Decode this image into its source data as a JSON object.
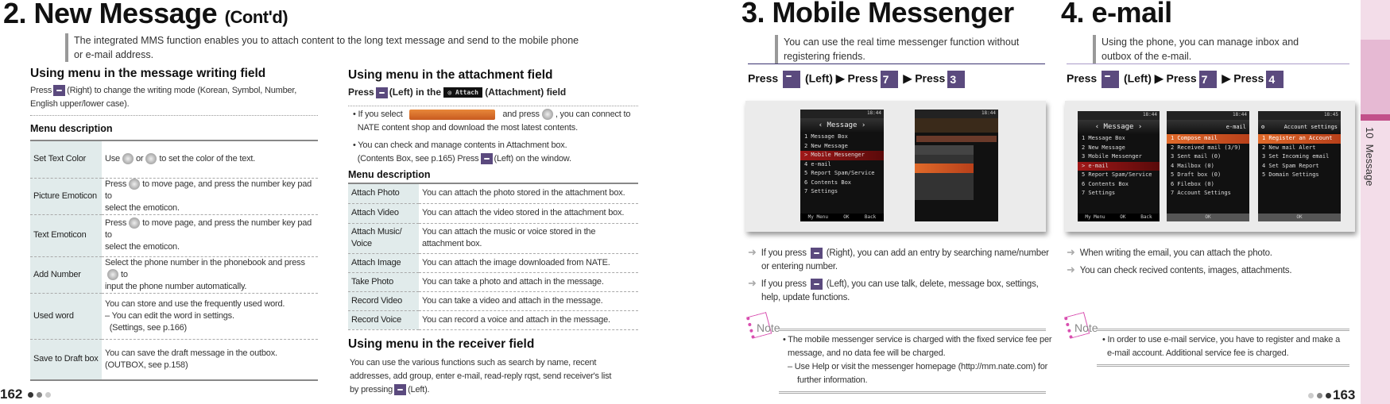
{
  "left_page": {
    "title_num": "2.",
    "title": "New Message",
    "title_suffix": "(Cont'd)",
    "intro": [
      "The integrated MMS function enables you to attach content to the long text message and send to the mobile phone",
      "or e-mail address."
    ],
    "writing_field": {
      "heading": "Using menu in the message writing field",
      "text_pre": "Press",
      "text_post": "(Right) to change the writing mode (Korean, Symbol, Number,",
      "text_line2": "English upper/lower case).",
      "menu_heading": "Menu description",
      "rows": [
        {
          "name": "Set Text Color",
          "desc": [
            "Use",
            "or",
            "to set the color of the text."
          ]
        },
        {
          "name": "Picture Emoticon",
          "desc": [
            "Press",
            "to move page, and press the number key pad to",
            "select the emoticon."
          ]
        },
        {
          "name": "Text Emoticon",
          "desc": [
            "Press",
            "to move page, and  press the number key pad to",
            "select the emoticon."
          ]
        },
        {
          "name": "Add Number",
          "desc": [
            "Select the phone number in the phonebook and press",
            "to",
            "input the phone number automatically."
          ]
        },
        {
          "name": "Used word",
          "desc": [
            "You can store and use the frequently used word.",
            "–  You can edit the word in settings.",
            "(Settings, see p.166)"
          ]
        },
        {
          "name": "Save to Draft box",
          "desc": [
            "You can save the draft message in the outbox.",
            "(OUTBOX, see p.158)"
          ]
        }
      ]
    },
    "attachment_field": {
      "heading": "Using menu in the attachment field",
      "press": "Press",
      "press_mid": "(Left)  in  the",
      "attach_chip": "Attach",
      "press_end": "(Attachment)  field",
      "bullet1": [
        "• If you select",
        "and press",
        ", you can connect to",
        "NATE content shop and download the most latest contents."
      ],
      "bullet2": [
        "• You can check and manage contents in Attachment box.",
        "(Contents Box, see p.165) Press",
        "(Left) on the window."
      ],
      "menu_heading": "Menu description",
      "rows": [
        {
          "name": "Attach Photo",
          "desc": "You can attach the photo stored in the attachment box."
        },
        {
          "name": "Attach Video",
          "desc": "You can attach the video stored in the attachment box."
        },
        {
          "name": "Attach Music/ Voice",
          "desc": "You can attach the music or voice stored in the attachment box."
        },
        {
          "name": "Attach Image",
          "desc": "You can attach the image downloaded from NATE."
        },
        {
          "name": "Take Photo",
          "desc": "You can take a photo and attach in the message."
        },
        {
          "name": "Record Video",
          "desc": "You can take a video and attach in the message."
        },
        {
          "name": "Record Voice",
          "desc": "You can record a voice and attach in the message."
        }
      ]
    },
    "receiver_field": {
      "heading": "Using menu in the receiver field",
      "lines": [
        "You can use the various functions such as search by name, recent",
        "addresses, add group, enter e-mail, read-reply rqst, send receiver's list",
        "by pressing"
      ],
      "end": "(Left)."
    },
    "page_number": "162"
  },
  "messenger": {
    "title_num": "3.",
    "title": "Mobile Messenger",
    "intro": [
      "You can use the real time messenger function without",
      "registering friends."
    ],
    "steps": {
      "press": "Press",
      "left": "(Left)",
      "key1": "7",
      "key2": "3"
    },
    "phone1": {
      "status": "18:44",
      "header": "Message",
      "items": [
        "1 Message Box",
        "2 New Message",
        "> Mobile Messenger",
        "4 e-mail",
        "5 Report Spam/Service",
        "6 Contents Box",
        "7 Settings"
      ],
      "selected": 2,
      "footer": [
        "My Menu",
        "OK",
        "Back"
      ]
    },
    "phone2": {
      "status": "18:44"
    },
    "bullets": [
      [
        "If you press",
        "(Right), you can add an entry by searching name/number",
        "or entering number."
      ],
      [
        "If you press",
        "(Left), you can use talk, delete, message box, settings,",
        "help, update functions."
      ]
    ],
    "note_label": "Note",
    "note": [
      "• The mobile messenger service is charged with the fixed service fee per",
      "message, and no data fee will be charged.",
      "–  Use Help or visit the messenger homepage (http://mm.nate.com) for",
      "further information."
    ]
  },
  "email": {
    "title_num": "4.",
    "title": "e-mail",
    "intro": [
      "Using the phone, you can manage inbox and",
      "outbox of the e-mail."
    ],
    "steps": {
      "press": "Press",
      "left": "(Left)",
      "key1": "7",
      "key2": "4"
    },
    "phone1": {
      "status": "18:44",
      "header": "Message",
      "items": [
        "1 Message Box",
        "2 New Message",
        "3 Mobile Messenger",
        "> e-mail",
        "5 Report Spam/Service",
        "6 Contents Box",
        "7 Settings"
      ],
      "selected": 3,
      "footer": [
        "My Menu",
        "OK",
        "Back"
      ]
    },
    "phone2": {
      "status": "18:44",
      "header": "e-mail",
      "items": [
        "1 Compose mail",
        "2 Received mail (3/9)",
        "3 Sent mail (0)",
        "4 Mailbox (0)",
        "5 Draft box (0)",
        "6 Filebox (0)",
        "7 Account Settings"
      ],
      "selected": 0,
      "footer": [
        "OK"
      ]
    },
    "phone3": {
      "status": "18:45",
      "header": "Account settings",
      "items": [
        "1 Register an Account",
        "2 New mail Alert",
        "3 Set Incoming email",
        "4 Set Spam Report",
        "5 Domain Settings"
      ],
      "selected": 0,
      "footer": [
        "OK"
      ]
    },
    "bullets": [
      "When writing the email, you can attach the photo.",
      "You can check recived contents, images, attachments."
    ],
    "note_label": "Note",
    "note": [
      "• In order to use e-mail service, you have to register and make a",
      "e-mail account. Additional service fee is charged."
    ]
  },
  "sidebar": {
    "chapter": "10  Message"
  },
  "page_number_right": "163",
  "colors": {
    "key": "#5b4a7e",
    "table_key_bg": "#e1ebeb",
    "sidebar": "#f3dde9",
    "sidebar_accent": "#c2508a",
    "note": "#d94fb0"
  }
}
